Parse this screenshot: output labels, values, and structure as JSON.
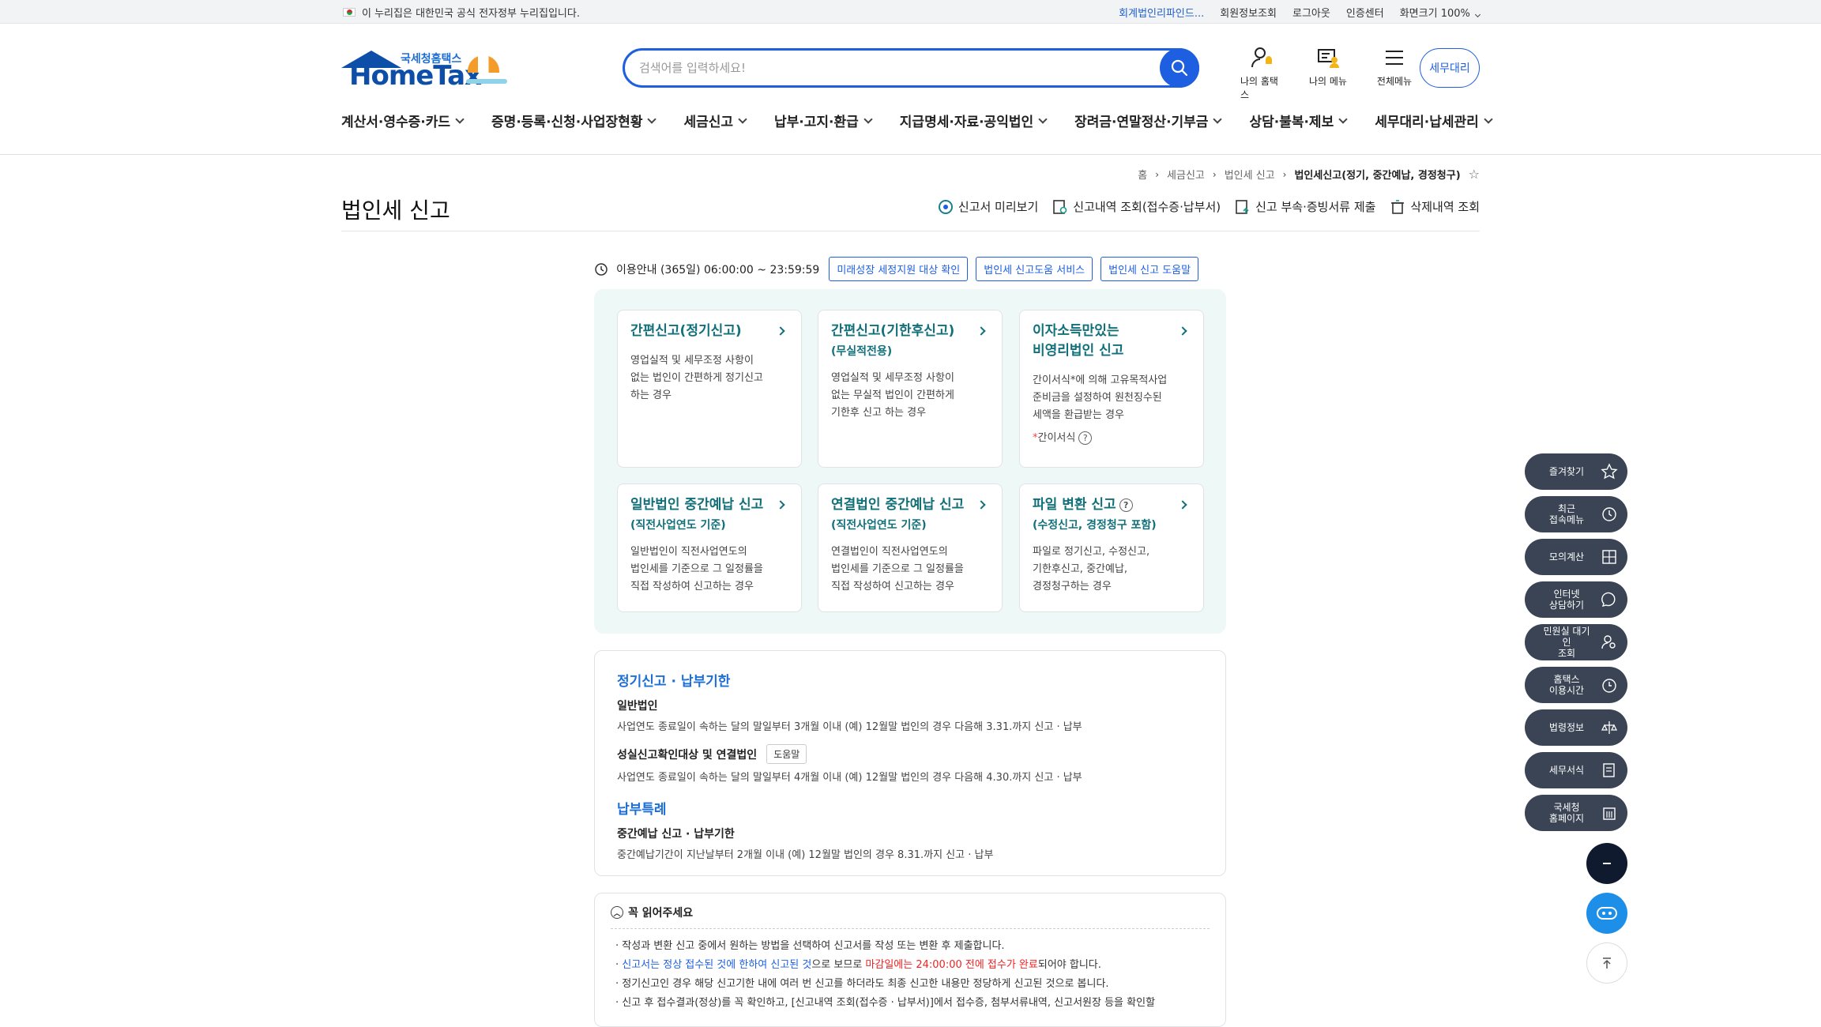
{
  "gov_bar": {
    "notice": "이 누리집은 대한민국 공식 전자정부 누리집입니다.",
    "links": [
      "회계법인리파인드...",
      "회원정보조회",
      "로그아웃",
      "인증센터"
    ],
    "zoom_label": "화면크기",
    "zoom_value": "100%"
  },
  "logo": {
    "small": "국세청홈택스",
    "big": "HomeTax"
  },
  "search": {
    "placeholder": "검색어를 입력하세요!"
  },
  "header_icons": {
    "my_hometax": "나의 홈택스",
    "my_menu": "나의 메뉴",
    "all_menu": "전체메뉴",
    "tax_agent": "세무대리"
  },
  "main_nav": [
    "계산서·영수증·카드",
    "증명·등록·신청·사업장현황",
    "세금신고",
    "납부·고지·환급",
    "지급명세·자료·공익법인",
    "장려금·연말정산·기부금",
    "상담·불복·제보",
    "세무대리·납세관리"
  ],
  "breadcrumb": [
    "홈",
    "세금신고",
    "법인세 신고",
    "법인세신고(정기, 중간예납, 경정청구)"
  ],
  "page_title": "법인세 신고",
  "title_actions": [
    "신고서 미리보기",
    "신고내역 조회(접수증·납부서)",
    "신고 부속·증빙서류 제출",
    "삭제내역 조회"
  ],
  "usage": {
    "text": "이용안내 (365일) 06:00:00 ~ 23:59:59",
    "buttons": [
      "미래성장 세정지원 대상 확인",
      "법인세 신고도움 서비스",
      "법인세 신고 도움말"
    ]
  },
  "cards": [
    {
      "title": "간편신고(정기신고)",
      "sub": "",
      "desc": [
        "영업실적 및 세무조정 사항이",
        "없는 법인이 간편하게 정기신고",
        "하는 경우"
      ]
    },
    {
      "title": "간편신고(기한후신고)",
      "sub": "(무실적전용)",
      "desc": [
        "영업실적 및 세무조정 사항이",
        "없는 무실적 법인이 간편하게",
        "기한후 신고 하는 경우"
      ]
    },
    {
      "title": "이자소득만있는",
      "title2": "비영리법인 신고",
      "sub": "",
      "desc": [
        "간이서식*에 의해 고유목적사업",
        "준비금을 설정하여 원천징수된",
        "세액을 환급받는 경우"
      ],
      "note": "간이서식"
    },
    {
      "title": "일반법인 중간예납 신고",
      "sub": "(직전사업연도 기준)",
      "desc": [
        "일반법인이 직전사업연도의",
        "법인세를 기준으로 그 일정률을",
        "직접 작성하여 신고하는 경우"
      ]
    },
    {
      "title": "연결법인 중간예납 신고",
      "sub": "(직전사업연도 기준)",
      "desc": [
        "연결법인이 직전사업연도의",
        "법인세를 기준으로 그 일정률을",
        "직접 작성하여 신고하는 경우"
      ]
    },
    {
      "title": "파일 변환 신고",
      "sub": "(수정신고, 경정청구 포함)",
      "desc": [
        "파일로 정기신고, 수정신고,",
        "기한후신고, 중간예납,",
        "경정청구하는 경우"
      ]
    }
  ],
  "info": {
    "h1": "정기신고 · 납부기한",
    "general_label": "일반법인",
    "general_desc": "사업연도 종료일이 속하는 달의 말일부터 3개월 이내 (예) 12월말 법인의 경우 다음해 3.31.까지 신고 · 납부",
    "faithful_label": "성실신고확인대상 및 연결법인",
    "help_btn": "도움말",
    "faithful_desc": "사업연도 종료일이 속하는 달의 말일부터 4개월 이내 (예) 12월말 법인의 경우 다음해 4.30.까지 신고 · 납부",
    "h2": "납부특례",
    "interim_label": "중간예납 신고 · 납부기한",
    "interim_desc": "중간예납기간이 지난날부터 2개월 이내 (예) 12월말 법인의 경우 8.31.까지 신고 · 납부"
  },
  "must_read": {
    "title": "꼭 읽어주세요",
    "items": [
      {
        "a": "작성과 변환 신고 중에서 원하는 방법을 선택하여 신고서를 작성 또는 변환 후 제출합니다."
      },
      {
        "blue": "신고서는 정상 접수된 것에 한하여 신고된 것",
        "mid": "으로 보므로 ",
        "red": "마감일에는 24:00:00 전에 접수가 완료",
        "end": "되어야 합니다."
      },
      {
        "a": "정기신고인 경우 해당 신고기한 내에 여러 번 신고를 하더라도 최종 신고한 내용만 정당하게 신고된 것으로 봅니다."
      },
      {
        "a": "신고 후 접수결과(정상)를 꼭 확인하고, [신고내역 조회(접수증 · 납부서)]에서 접수증, 첨부서류내역, 신고서원장 등을 확인할"
      }
    ]
  },
  "quick_menu": [
    {
      "l1": "즐겨찾기",
      "l2": "",
      "icon": "star-icon"
    },
    {
      "l1": "최근",
      "l2": "접속메뉴",
      "icon": "clock-icon"
    },
    {
      "l1": "모의계산",
      "l2": "",
      "icon": "calculator-icon"
    },
    {
      "l1": "인터넷",
      "l2": "상담하기",
      "icon": "chat-icon"
    },
    {
      "l1": "민원실 대기인",
      "l2": "조회",
      "icon": "person-search-icon"
    },
    {
      "l1": "홈택스",
      "l2": "이용시간",
      "icon": "alarm-icon"
    },
    {
      "l1": "법령정보",
      "l2": "",
      "icon": "scale-icon"
    },
    {
      "l1": "세무서식",
      "l2": "",
      "icon": "form-icon"
    },
    {
      "l1": "국세청",
      "l2": "홈페이지",
      "icon": "building-icon"
    }
  ]
}
